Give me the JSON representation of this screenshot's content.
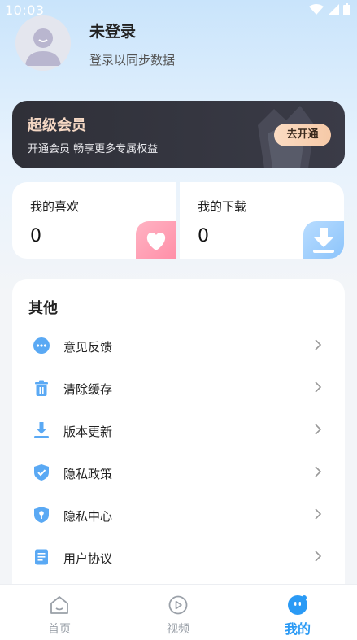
{
  "status_bar": {
    "time": "10:03"
  },
  "profile": {
    "name": "未登录",
    "subtitle": "登录以同步数据"
  },
  "vip": {
    "title": "超级会员",
    "subtitle": "开通会员 畅享更多专属权益",
    "button": "去开通"
  },
  "stats": [
    {
      "label": "我的喜欢",
      "value": "0",
      "icon": "heart-icon"
    },
    {
      "label": "我的下载",
      "value": "0",
      "icon": "download-icon"
    }
  ],
  "other": {
    "title": "其他",
    "items": [
      {
        "label": "意见反馈",
        "icon": "feedback-icon"
      },
      {
        "label": "清除缓存",
        "icon": "trash-icon"
      },
      {
        "label": "版本更新",
        "icon": "update-icon"
      },
      {
        "label": "隐私政策",
        "icon": "shield-check-icon"
      },
      {
        "label": "隐私中心",
        "icon": "shield-key-icon"
      },
      {
        "label": "用户协议",
        "icon": "document-icon"
      }
    ]
  },
  "tabbar": {
    "tabs": [
      {
        "label": "首页",
        "icon": "home-icon"
      },
      {
        "label": "视频",
        "icon": "video-icon"
      },
      {
        "label": "我的",
        "icon": "mine-icon",
        "active": true
      }
    ]
  },
  "colors": {
    "accent": "#2a9af5",
    "vip_bg": "#2f3038",
    "vip_gold": "#f5d8c4",
    "icon_blue": "#5aa9f4"
  }
}
